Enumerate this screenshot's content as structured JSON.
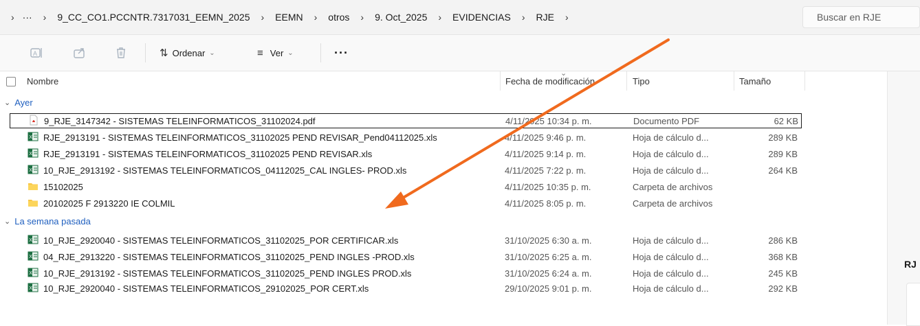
{
  "breadcrumbs": [
    "9_CC_CO1.PCCNTR.7317031_EEMN_2025",
    "EEMN",
    "otros",
    "9. Oct_2025",
    "EVIDENCIAS",
    "RJE"
  ],
  "breadcrumb_more": "···",
  "search": {
    "placeholder": "Buscar en RJE"
  },
  "toolbar": {
    "sort_label": "Ordenar",
    "view_label": "Ver",
    "more_label": "···"
  },
  "columns": {
    "name": "Nombre",
    "date": "Fecha de modificación",
    "type": "Tipo",
    "size": "Tamaño"
  },
  "groups": [
    {
      "label": "Ayer",
      "files": [
        {
          "name": "9_RJE_3147342 - SISTEMAS TELEINFORMATICOS_31102024.pdf",
          "date": "4/11/2025 10:34 p. m.",
          "type": "Documento PDF",
          "size": "62 KB",
          "icon": "pdf-icon"
        },
        {
          "name": "RJE_2913191 - SISTEMAS TELEINFORMATICOS_31102025 PEND REVISAR_Pend04112025.xls",
          "date": "4/11/2025 9:46 p. m.",
          "type": "Hoja de cálculo d...",
          "size": "289 KB",
          "icon": "excel-icon"
        },
        {
          "name": "RJE_2913191 - SISTEMAS TELEINFORMATICOS_31102025 PEND REVISAR.xls",
          "date": "4/11/2025 9:14 p. m.",
          "type": "Hoja de cálculo d...",
          "size": "289 KB",
          "icon": "excel-icon"
        },
        {
          "name": "10_RJE_2913192 - SISTEMAS TELEINFORMATICOS_04112025_CAL INGLES- PROD.xls",
          "date": "4/11/2025 7:22 p. m.",
          "type": "Hoja de cálculo d...",
          "size": "264 KB",
          "icon": "excel-icon"
        },
        {
          "name": "15102025",
          "date": "4/11/2025 10:35 p. m.",
          "type": "Carpeta de archivos",
          "size": "",
          "icon": "folder-icon"
        },
        {
          "name": "20102025 F 2913220 IE COLMIL",
          "date": "4/11/2025 8:05 p. m.",
          "type": "Carpeta de archivos",
          "size": "",
          "icon": "folder-icon"
        }
      ]
    },
    {
      "label": "La semana pasada",
      "files": [
        {
          "name": "10_RJE_2920040 - SISTEMAS TELEINFORMATICOS_31102025_POR CERTIFICAR.xls",
          "date": "31/10/2025 6:30 a. m.",
          "type": "Hoja de cálculo d...",
          "size": "286 KB",
          "icon": "excel-icon"
        },
        {
          "name": "04_RJE_2913220 - SISTEMAS TELEINFORMATICOS_31102025_PEND INGLES -PROD.xls",
          "date": "31/10/2025 6:25 a. m.",
          "type": "Hoja de cálculo d...",
          "size": "368 KB",
          "icon": "excel-icon"
        },
        {
          "name": "10_RJE_2913192 - SISTEMAS TELEINFORMATICOS_31102025_PEND INGLES PROD.xls",
          "date": "31/10/2025 6:24 a. m.",
          "type": "Hoja de cálculo d...",
          "size": "245 KB",
          "icon": "excel-icon"
        },
        {
          "name": "10_RJE_2920040 - SISTEMAS TELEINFORMATICOS_29102025_POR CERT.xls",
          "date": "29/10/2025 9:01 p. m.",
          "type": "Hoja de cálculo d...",
          "size": "292 KB",
          "icon": "excel-icon"
        }
      ]
    }
  ],
  "details_pane": {
    "title": "RJ"
  },
  "annotation": {
    "arrow_color": "#f06a1e"
  }
}
